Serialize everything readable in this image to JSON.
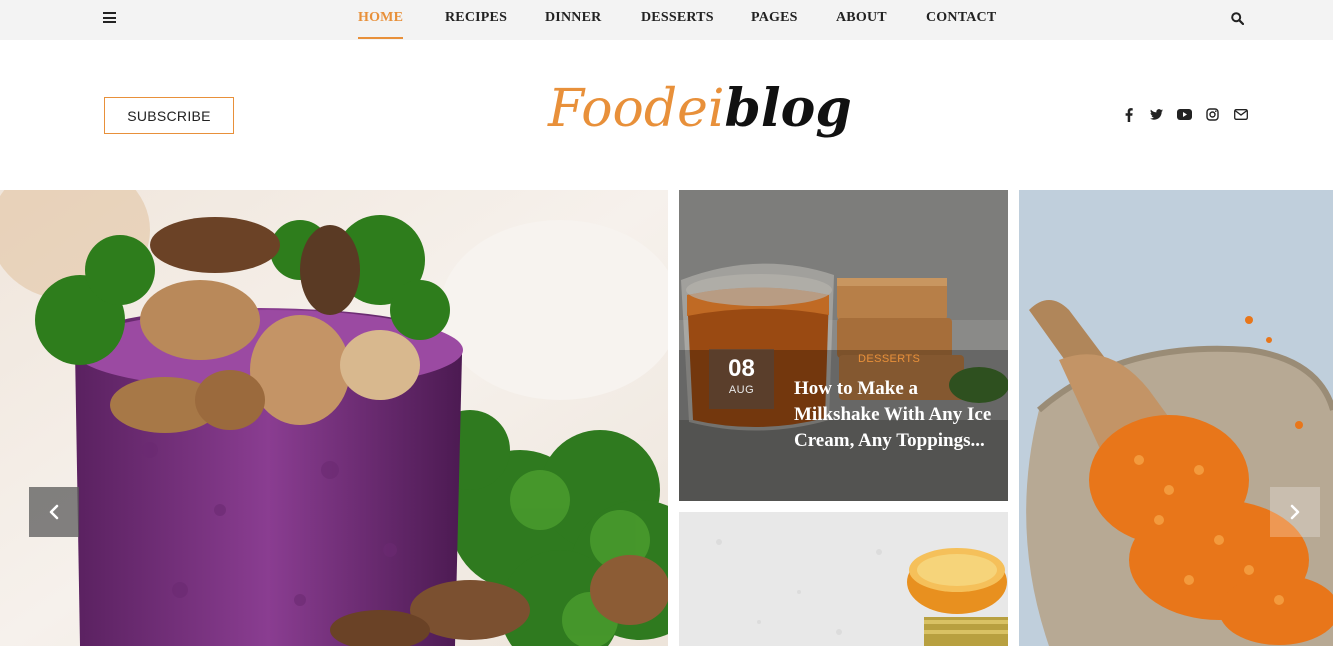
{
  "nav": {
    "items": [
      {
        "label": "HOME",
        "active": true
      },
      {
        "label": "RECIPES"
      },
      {
        "label": "DINNER"
      },
      {
        "label": "DESSERTS"
      },
      {
        "label": "PAGES"
      },
      {
        "label": "ABOUT"
      },
      {
        "label": "CONTACT"
      }
    ]
  },
  "header": {
    "subscribe_label": "SUBSCRIBE",
    "logo_part1": "Foodei",
    "logo_part2": "blog",
    "social_icons": [
      "facebook-icon",
      "twitter-icon",
      "youtube-icon",
      "instagram-icon",
      "envelope-icon"
    ]
  },
  "slider": {
    "featured_post": {
      "date_day": "08",
      "date_month": "AUG",
      "category": "DESSERTS",
      "title": "How to Make a Milkshake With Any Ice Cream, Any Toppings..."
    }
  },
  "colors": {
    "accent": "#e8903a",
    "topbar_bg": "#f3f3f3",
    "text": "#222222"
  }
}
